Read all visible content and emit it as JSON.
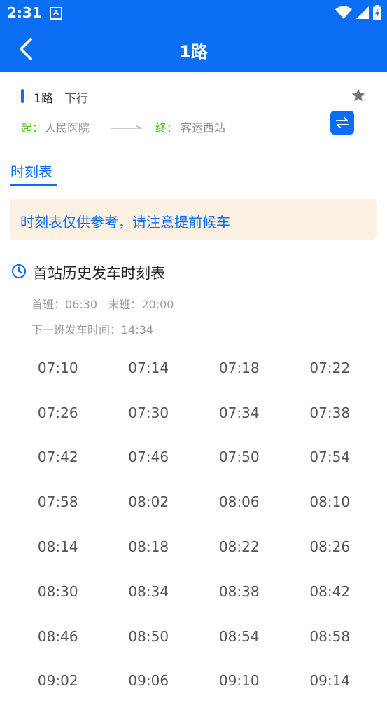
{
  "statusbar": {
    "time": "2:31",
    "notification_glyph": "A",
    "icons": [
      "wifi-icon",
      "signal-icon",
      "battery-icon"
    ]
  },
  "appbar": {
    "title": "1路"
  },
  "route": {
    "name": "1路",
    "direction": "下行",
    "start_key": "起：",
    "start_stop": "人民医院",
    "end_key": "终：",
    "end_stop": "客运西站"
  },
  "tabs": [
    {
      "label": "时刻表",
      "active": true
    }
  ],
  "notice": {
    "text": "时刻表仅供参考，请注意提前候车"
  },
  "schedule": {
    "title": "首站历史发车时刻表",
    "first_last": "首班：06:30   末班：20:00",
    "next_bus": "下一班发车时间：14:34",
    "times": [
      "07:10",
      "07:14",
      "07:18",
      "07:22",
      "07:26",
      "07:30",
      "07:34",
      "07:38",
      "07:42",
      "07:46",
      "07:50",
      "07:54",
      "07:58",
      "08:02",
      "08:06",
      "08:10",
      "08:14",
      "08:18",
      "08:22",
      "08:26",
      "08:30",
      "08:34",
      "08:38",
      "08:42",
      "08:46",
      "08:50",
      "08:54",
      "08:58",
      "09:02",
      "09:06",
      "09:10",
      "09:14"
    ]
  },
  "colors": {
    "primary": "#0a6ef5",
    "green": "#52c41a",
    "notice_bg": "#fdf1e4",
    "muted_text": "#9a9a9a"
  }
}
